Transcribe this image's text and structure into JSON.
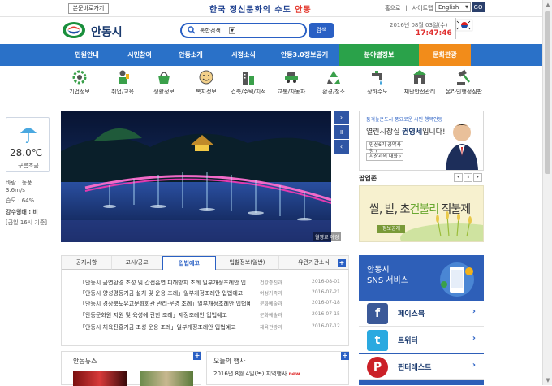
{
  "topbar": {
    "skip_label": "본문바로가기",
    "slogan_prefix": "한국 정신문화의 수도",
    "slogan_city": "안동",
    "links": [
      "홈으로",
      "사이트맵"
    ],
    "language": "English",
    "go_label": "GO"
  },
  "header": {
    "logo_text": "안동시",
    "search_scope": "통합검색",
    "search_button": "검색",
    "date": "2016년 08월 03일(수)",
    "time": "17:47:46"
  },
  "nav": {
    "items": [
      "민원안내",
      "시민참여",
      "안동소개",
      "시정소식",
      "안동3.0정보공개",
      "분야별정보",
      "문화관광"
    ]
  },
  "quick_icons": {
    "items": [
      "기업정보",
      "취업/교육",
      "생활정보",
      "복지정보",
      "건축/주택/지적",
      "교통/자동차",
      "환경/청소",
      "상하수도",
      "재난안전관리",
      "온라인행정심판"
    ]
  },
  "weather": {
    "temperature": "28.0℃",
    "condition": "구름조금",
    "wind_label": "바람 : 동풍",
    "wind_speed": "3.6m/s",
    "humidity": "습도 : 64%",
    "precip": "강수형태 : 비",
    "updated": "[금일 16시 기준]"
  },
  "slideshow": {
    "caption": "월영교 야경",
    "controls": [
      "›",
      "॥",
      "‹"
    ]
  },
  "mayor": {
    "tagline": "품격높은도시 풍요로운 시민 행복안동",
    "title_prefix": "열린시장실 ",
    "title_name": "권영세",
    "title_suffix": "입니다!",
    "btn_pledge": "민선6기 공약사항 ›",
    "btn_talk": "시장과의 대화 ›"
  },
  "popup": {
    "title": "팝업존",
    "controls": [
      "◂",
      "॥",
      "▸"
    ],
    "banner_text_a": "쌀, 밭, 초",
    "banner_text_b": "건불리",
    "banner_text_c": " 직불제",
    "banner_button": "정보공개"
  },
  "news_tabs": {
    "tabs": [
      "공지사항",
      "고시/공고",
      "입법예고",
      "입찰정보(일반)",
      "유관기관소식"
    ],
    "rows": [
      {
        "title": "「안동시 금연환경 조성 및 간접흡연 피해방지 조례 일부개정조례안 입...",
        "dept": "건강증진과",
        "date": "2016-08-01"
      },
      {
        "title": "「안동시 양성평등기금 설치 및 운용 조례」일부개정조례안 입법예고",
        "dept": "여성가족과",
        "date": "2016-07-21"
      },
      {
        "title": "「안동시 경상북도유교문화회관 관리·운영 조례」일부개정조례안 입법예...",
        "dept": "문화예술과",
        "date": "2016-07-18"
      },
      {
        "title": "「안동문화원 지원 및 육성에 관한 조례」제정조례안 입법예고",
        "dept": "문화예술과",
        "date": "2016-07-15"
      },
      {
        "title": "「안동시 체육진흥기금 조성 운용 조례」일부개정조례안 입법예고",
        "dept": "체육관광과",
        "date": "2016-07-12"
      }
    ],
    "more": "+"
  },
  "sns": {
    "title_line1": "안동시",
    "title_line2": "SNS 서비스",
    "items": [
      {
        "label": "페이스북",
        "icon": "f"
      },
      {
        "label": "트위터",
        "icon": "t"
      },
      {
        "label": "핀터레스트",
        "icon": "P"
      }
    ]
  },
  "andong_news": {
    "title": "안동뉴스",
    "more": "+"
  },
  "events": {
    "title": "오늘의 행사",
    "item": "2016년 8월 4일(목) 지역행사",
    "badge": "new",
    "more": "+"
  },
  "colors": {
    "nav_blue": "#2a71c8",
    "nav_green": "#2aa24a",
    "nav_orange": "#f28c1a",
    "accent_red": "#e03030"
  }
}
